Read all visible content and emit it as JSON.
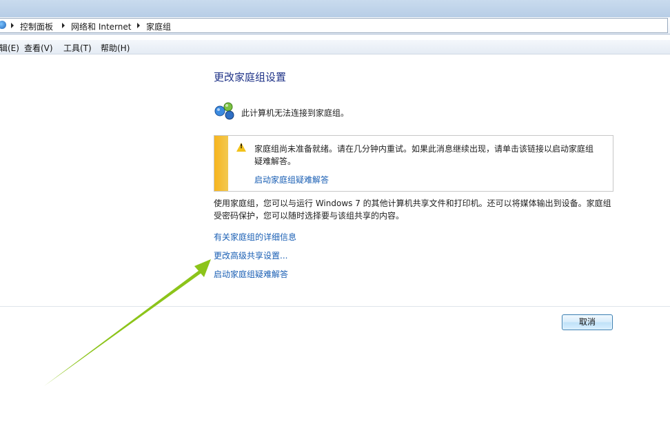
{
  "address": {
    "crumbs": [
      "控制面板",
      "网络和 Internet",
      "家庭组"
    ]
  },
  "menu": {
    "items": [
      "辑(E)",
      "查看(V)",
      "工具(T)",
      "帮助(H)"
    ]
  },
  "main": {
    "title": "更改家庭组设置",
    "status": "此计算机无法连接到家庭组。",
    "warning": {
      "text": "家庭组尚未准备就绪。请在几分钟内重试。如果此消息继续出现，请单击该链接以启动家庭组疑难解答。",
      "link": "启动家庭组疑难解答"
    },
    "description": "使用家庭组，您可以与运行 Windows 7 的其他计算机共享文件和打印机。还可以将媒体输出到设备。家庭组受密码保护，您可以随时选择要与该组共享的内容。",
    "links": [
      "有关家庭组的详细信息",
      "更改高级共享设置...",
      "启动家庭组疑难解答"
    ]
  },
  "footer": {
    "cancel_label": "取消"
  },
  "colors": {
    "link": "#1a5fb4",
    "title": "#1e3287",
    "warning_strip": "#f7b51e",
    "annotation_arrow": "#8cc41a"
  }
}
